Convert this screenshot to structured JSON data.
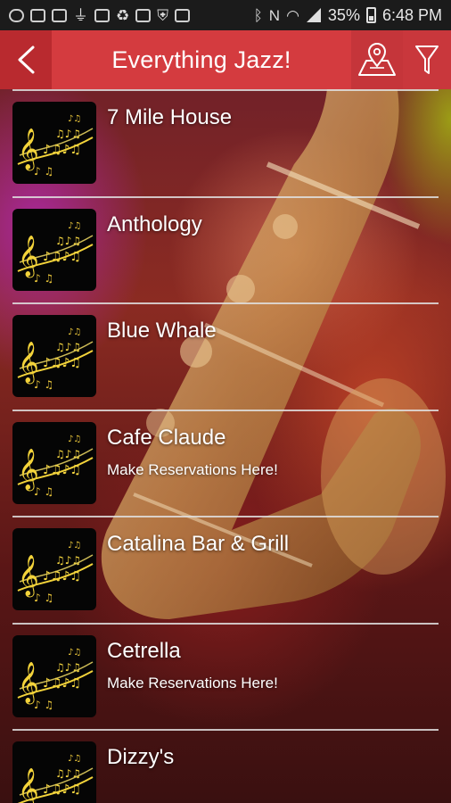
{
  "statusbar": {
    "battery": "35%",
    "time": "6:48 PM",
    "left_icons": [
      "message-icon",
      "cast-icon",
      "cast-icon",
      "usb-icon",
      "image-icon",
      "recycle-icon",
      "mail-icon",
      "shield-icon",
      "mail-icon"
    ],
    "right_icons": [
      "bluetooth-icon",
      "nfc-icon",
      "wifi-icon",
      "signal-icon",
      "battery-icon"
    ]
  },
  "appbar": {
    "title": "Everything Jazz!",
    "back_icon": "chevron-left-icon",
    "map_icon": "map-pin-icon",
    "filter_icon": "filter-icon",
    "colors": {
      "back": "#b92a2f",
      "title": "#d43b3f",
      "actions": "#c5353a"
    }
  },
  "venues": [
    {
      "name": "7 Mile House",
      "subtitle": ""
    },
    {
      "name": "Anthology",
      "subtitle": ""
    },
    {
      "name": "Blue Whale",
      "subtitle": ""
    },
    {
      "name": "Cafe Claude",
      "subtitle": "Make Reservations Here!"
    },
    {
      "name": "Catalina Bar & Grill",
      "subtitle": ""
    },
    {
      "name": "Cetrella",
      "subtitle": "Make Reservations Here!"
    },
    {
      "name": "Dizzy's",
      "subtitle": ""
    }
  ],
  "thumbnail_icon": "music-notes-icon"
}
